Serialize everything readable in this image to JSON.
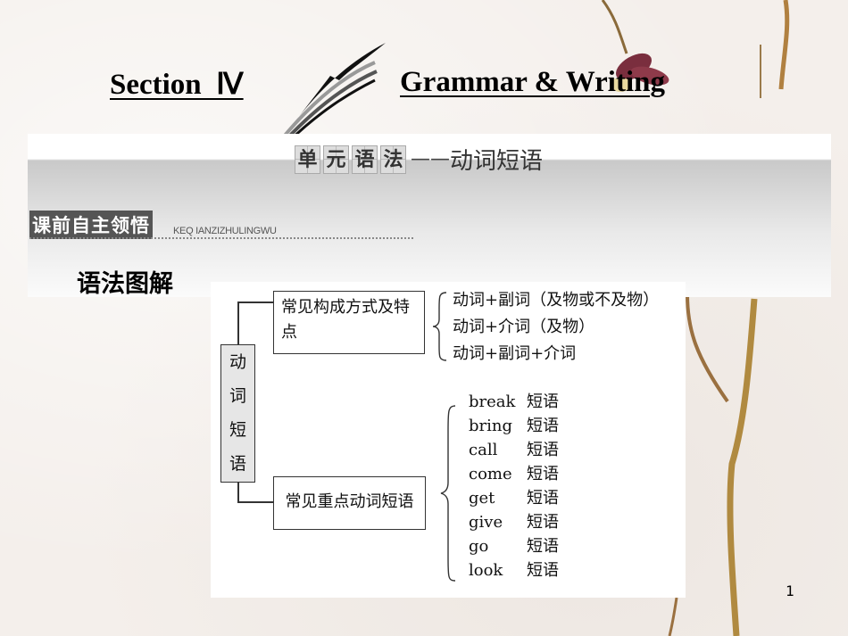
{
  "header": {
    "section_title": "Section  Ⅳ",
    "topic_title": "Grammar & Writing"
  },
  "unit_heading": {
    "tiles": [
      "单",
      "元",
      "语",
      "法"
    ],
    "dash": "——",
    "subtitle": "动词短语"
  },
  "section_label": {
    "label": "课前自主领悟",
    "pinyin": "KEQ IANZIZHULINGWU"
  },
  "grammar_label": "语法图解",
  "diagram": {
    "root": [
      "动",
      "词",
      "短",
      "语"
    ],
    "formation": {
      "title": "常见构成方式及特点",
      "items": [
        "动词+副词（及物或不及物）",
        "动词+介词（及物）",
        "动词+副词+介词"
      ]
    },
    "key_phrases": {
      "title": "常见重点动词短语",
      "items": [
        {
          "verb": "break",
          "suffix": "短语"
        },
        {
          "verb": "bring",
          "suffix": "短语"
        },
        {
          "verb": "call",
          "suffix": "短语"
        },
        {
          "verb": "come",
          "suffix": "短语"
        },
        {
          "verb": "get",
          "suffix": "短语"
        },
        {
          "verb": "give",
          "suffix": "短语"
        },
        {
          "verb": "go",
          "suffix": "短语"
        },
        {
          "verb": "look",
          "suffix": "短语"
        }
      ]
    }
  },
  "page_number": "1"
}
